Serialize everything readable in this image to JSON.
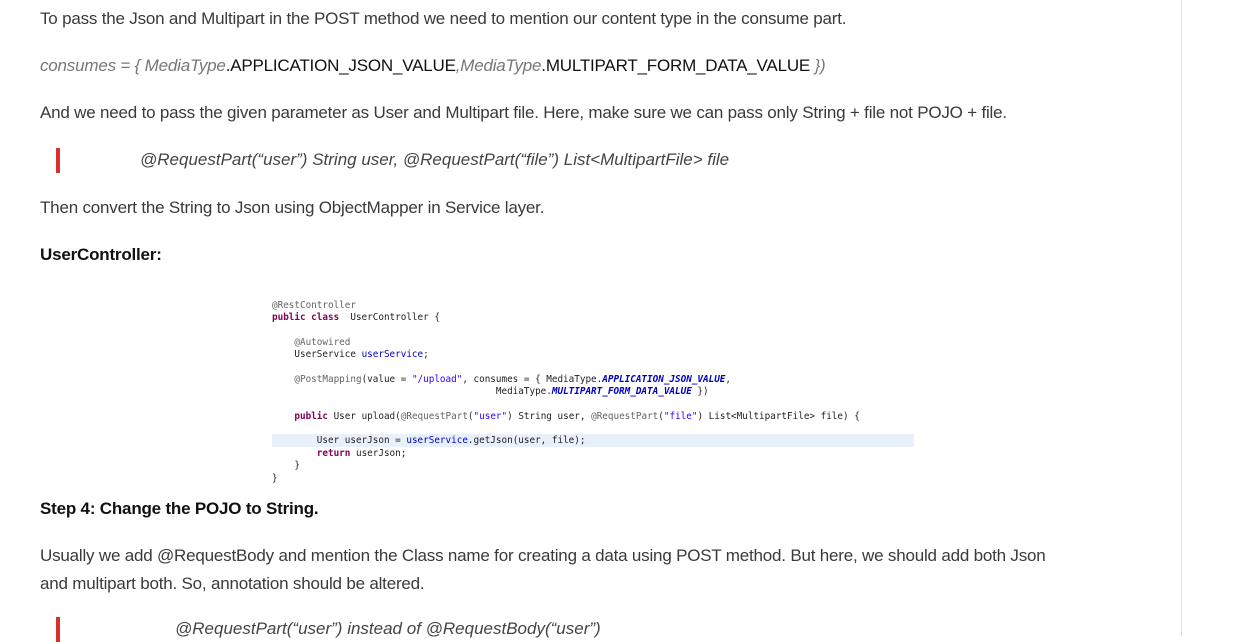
{
  "para1": "To pass the Json and Multipart in the POST method we need to mention our content type in the consume part.",
  "consumes": {
    "prefix": "consumes = { ",
    "type1": "MediaType",
    "val1": ".APPLICATION_JSON_VALUE",
    "sep": ",",
    "type2": "MediaType",
    "val2": ".MULTIPART_FORM_DATA_VALUE",
    "suffix": " })"
  },
  "para2": "And we need to pass the given parameter as User and Multipart file. Here, make sure we can pass only String + file not POJO + file.",
  "quote1": "@RequestPart(“user”) String user, @RequestPart(“file”) List<MultipartFile> file",
  "para3": "Then convert the String to Json using ObjectMapper in Service layer.",
  "heading1": "UserController:",
  "code": [
    {
      "indent": "",
      "segs": [
        [
          "an",
          "@RestController"
        ]
      ]
    },
    {
      "indent": "",
      "segs": [
        [
          "kw",
          "public class"
        ],
        [
          "",
          "  UserController {"
        ]
      ]
    },
    {
      "indent": "    ",
      "segs": [
        [
          "an",
          "@Autowired"
        ]
      ]
    },
    {
      "indent": "    ",
      "segs": [
        [
          "",
          "UserService "
        ],
        [
          "fd",
          "userService"
        ],
        [
          "",
          ";"
        ]
      ]
    },
    {
      "indent": "    ",
      "segs": [
        [
          "an",
          "@PostMapping"
        ],
        [
          "",
          "(value = "
        ],
        [
          "st",
          "\"/upload\""
        ],
        [
          "",
          ", consumes = { MediaType."
        ],
        [
          "sf",
          "APPLICATION_JSON_VALUE"
        ],
        [
          "",
          ","
        ]
      ]
    },
    {
      "indent": "                                        ",
      "segs": [
        [
          "",
          "MediaType."
        ],
        [
          "sf",
          "MULTIPART_FORM_DATA_VALUE"
        ],
        [
          "",
          " })"
        ]
      ]
    },
    {
      "indent": "    ",
      "segs": [
        [
          "kw",
          "public"
        ],
        [
          "",
          " User upload("
        ],
        [
          "an",
          "@RequestPart"
        ],
        [
          "",
          "("
        ],
        [
          "st",
          "\"user\""
        ],
        [
          "",
          ") String user, "
        ],
        [
          "an",
          "@RequestPart"
        ],
        [
          "",
          "("
        ],
        [
          "st",
          "\"file\""
        ],
        [
          "",
          ") List<MultipartFile> file) {"
        ]
      ]
    },
    {
      "indent": "        ",
      "segs": [
        [
          "",
          "User userJson = "
        ],
        [
          "fd",
          "userService"
        ],
        [
          "",
          ".getJson(user, file);"
        ]
      ],
      "highlight": true
    },
    {
      "indent": "        ",
      "segs": [
        [
          "kw",
          "return"
        ],
        [
          "",
          " userJson;"
        ]
      ]
    },
    {
      "indent": "    ",
      "segs": [
        [
          "",
          "}"
        ]
      ]
    },
    {
      "indent": "",
      "segs": [
        [
          "",
          "}"
        ]
      ]
    }
  ],
  "heading2": "Step 4: Change the POJO to String.",
  "para4a": "Usually we add @RequestBody and mention the Class name for creating a data using POST method. But here, we should add both Json",
  "para4b": "and multipart both. So, annotation should be altered.",
  "quote2": "@RequestPart(“user”) instead of @RequestBody(“user”)"
}
